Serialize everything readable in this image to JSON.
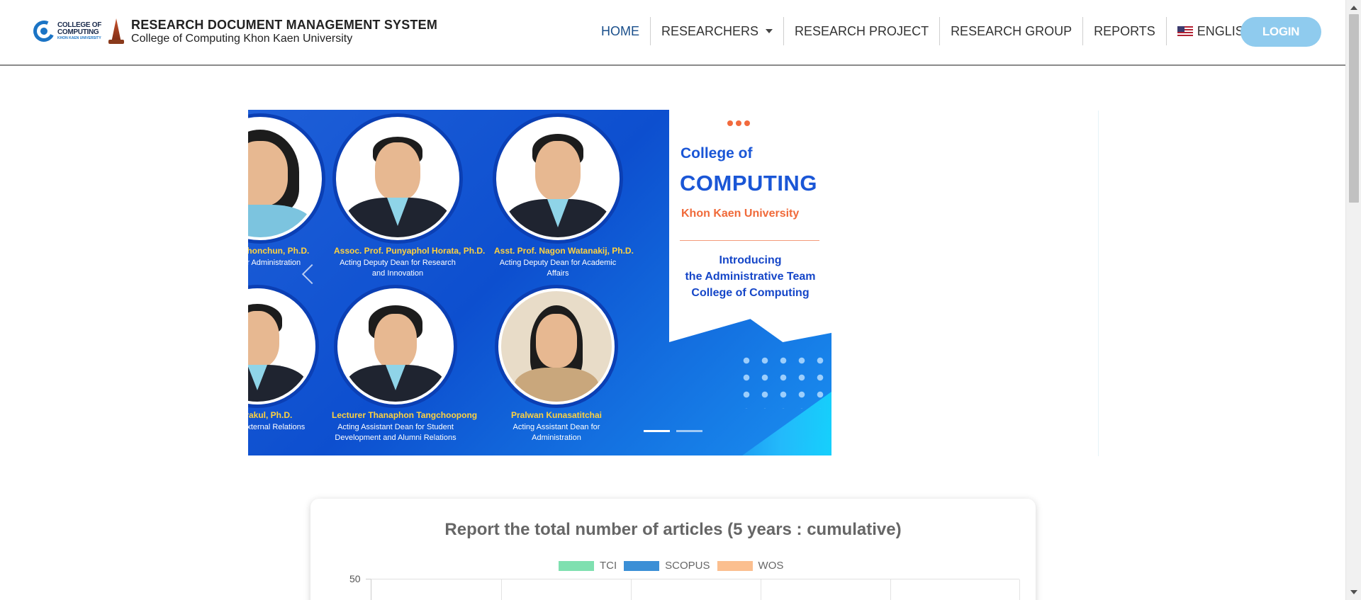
{
  "header": {
    "brand_logo_line1": "COLLEGE OF",
    "brand_logo_line2": "COMPUTING",
    "brand_logo_line3": "KHON KAEN UNIVERSITY",
    "title": "RESEARCH DOCUMENT MANAGEMENT SYSTEM",
    "subtitle": "College of Computing Khon Kaen University"
  },
  "nav": {
    "items": [
      {
        "label": "HOME",
        "active": true
      },
      {
        "label": "RESEARCHERS",
        "dropdown": true
      },
      {
        "label": "RESEARCH PROJECT"
      },
      {
        "label": "RESEARCH GROUP"
      },
      {
        "label": "REPORTS"
      },
      {
        "label": "ENGLISH",
        "dropdown": true,
        "icon": "us-flag-icon"
      }
    ],
    "login_label": "LOGIN"
  },
  "carousel": {
    "people": [
      {
        "name": "Intarasothonchun, Ph.D.",
        "role": "Dean for Administration"
      },
      {
        "name": "Assoc. Prof. Punyaphol Horata, Ph.D.",
        "role": "Acting Deputy Dean for Research and Innovation"
      },
      {
        "name": "Asst. Prof. Nagon Watanakij, Ph.D.",
        "role": "Acting Deputy Dean for Academic Affairs"
      },
      {
        "name": "chontrakul, Ph.D.",
        "role": "Dean for External Relations"
      },
      {
        "name": "Lecturer Thanaphon Tangchoopong",
        "role": "Acting Assistant Dean for Student Development and Alumni Relations"
      },
      {
        "name": "Pralwan Kunasatitchai",
        "role": "Acting Assistant Dean for Administration"
      }
    ],
    "panel": {
      "college_of": "College of",
      "computing": "COMPUTING",
      "university": "Khon Kaen University",
      "intro_line1": "Introducing",
      "intro_line2": "the Administrative Team",
      "intro_line3": "College of Computing"
    },
    "indicator_count": 2,
    "active_indicator": 0
  },
  "report": {
    "title": "Report the total number of articles (5 years : cumulative)",
    "y_max_label": "50",
    "legend": [
      {
        "label": "TCI",
        "color": "#7fe0b0"
      },
      {
        "label": "SCOPUS",
        "color": "#3b8fd6"
      },
      {
        "label": "WOS",
        "color": "#fbbf8f"
      }
    ]
  },
  "colors": {
    "accent": "#1a4f8b",
    "login_bg": "#8fcbee",
    "carousel_blue": "#0d4fcf"
  }
}
